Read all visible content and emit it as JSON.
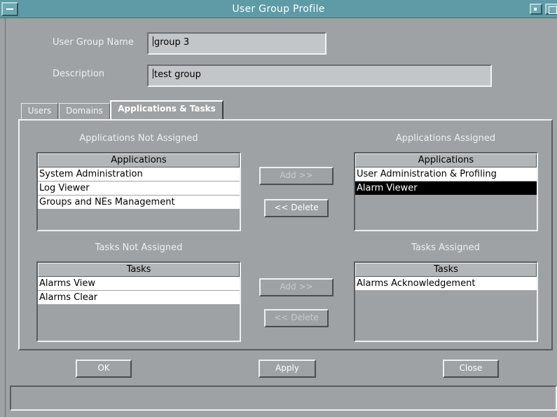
{
  "window": {
    "title": "User Group Profile"
  },
  "form": {
    "name_label": "User Group Name",
    "name_value": "group 3",
    "description_label": "Description",
    "description_value": "test group"
  },
  "tabs": [
    {
      "label": "Users",
      "active": false
    },
    {
      "label": "Domains",
      "active": false
    },
    {
      "label": "Applications & Tasks",
      "active": true
    }
  ],
  "applications": {
    "not_assigned_title": "Applications Not Assigned",
    "assigned_title": "Applications Assigned",
    "column_header": "Applications",
    "not_assigned": [
      "System Administration",
      "Log Viewer",
      "Groups and NEs Management"
    ],
    "assigned": [
      "User Administration & Profiling",
      "Alarm Viewer"
    ],
    "selected_assigned": "Alarm Viewer",
    "add_label": "Add >>",
    "delete_label": "<< Delete"
  },
  "tasks": {
    "not_assigned_title": "Tasks Not Assigned",
    "assigned_title": "Tasks Assigned",
    "column_header": "Tasks",
    "not_assigned": [
      "Alarms View",
      "Alarms Clear"
    ],
    "assigned": [
      "Alarms Acknowledgement"
    ],
    "add_label": "Add >>",
    "delete_label": "<< Delete"
  },
  "footer": {
    "ok_label": "OK",
    "apply_label": "Apply",
    "close_label": "Close"
  },
  "colors": {
    "titlebar": "#5e9ba6",
    "background": "#9ea2a5",
    "selection": "#000000"
  }
}
